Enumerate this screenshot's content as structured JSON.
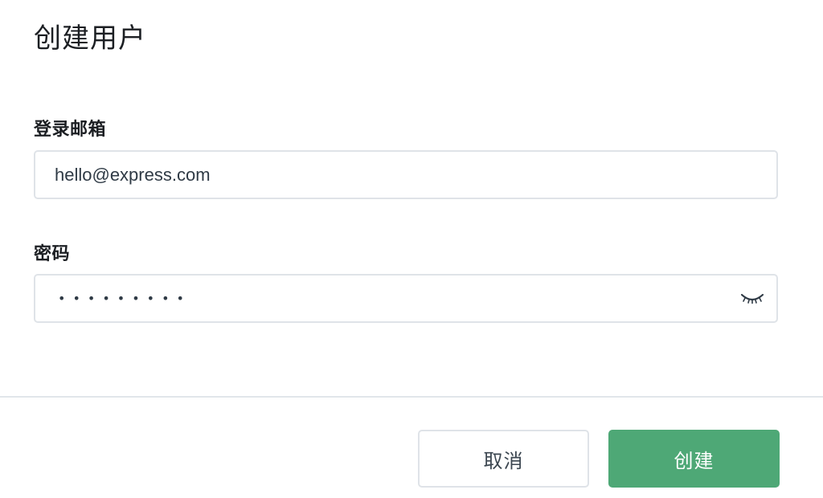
{
  "dialog": {
    "title": "创建用户"
  },
  "form": {
    "email": {
      "label": "登录邮箱",
      "value": "hello@express.com"
    },
    "password": {
      "label": "密码",
      "masked_value": "•••••••••",
      "toggle_icon": "eye-closed-icon"
    }
  },
  "actions": {
    "cancel_label": "取消",
    "create_label": "创建"
  },
  "colors": {
    "primary": "#4ea876",
    "border": "#dfe3e8",
    "text": "#1c1f23"
  }
}
